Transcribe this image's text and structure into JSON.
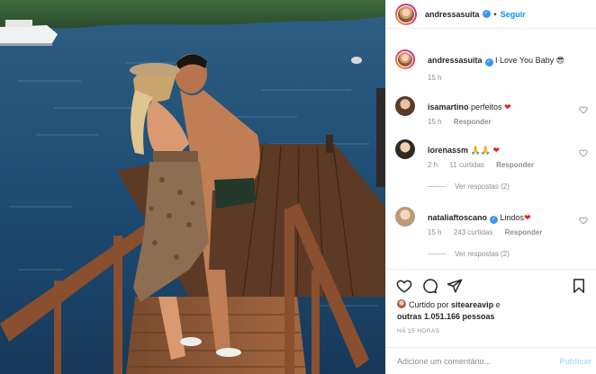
{
  "header": {
    "username": "andressasuita",
    "separator": "•",
    "follow_label": "Seguir"
  },
  "caption": {
    "username": "andressasuita",
    "text": "I Love You Baby 😎",
    "time": "15 h"
  },
  "comments": [
    {
      "username": "isamartino",
      "text": "perfeitos",
      "heart": "❤",
      "time": "15 h",
      "likes": "",
      "reply_label": "Responder",
      "view_replies": ""
    },
    {
      "username": "lorenassm",
      "text": "🙏🙏",
      "heart": "❤",
      "time": "2 h",
      "likes": "11 curtidas",
      "reply_label": "Responder",
      "view_replies": "Ver respostas (2)"
    },
    {
      "username": "nataliaftoscano",
      "text": "Lindos",
      "heart": "❤",
      "time": "15 h",
      "likes": "243 curtidas",
      "reply_label": "Responder",
      "view_replies": "Ver respostas (2)"
    }
  ],
  "likes": {
    "prefix": "Curtido por",
    "user": "siteareavip",
    "middle": "e",
    "others": "outras 1.051.166 pessoas"
  },
  "posted_ago": "HÁ 15 HORAS",
  "comment_box": {
    "placeholder": "Adicione um comentário...",
    "publish_label": "Publicar"
  },
  "icons": {
    "like": "heart-icon",
    "comment": "comment-icon",
    "share": "share-icon",
    "save": "bookmark-icon"
  },
  "colors": {
    "accent": "#0095f6",
    "verified": "#3897f0",
    "heart": "#ed4956",
    "muted": "#8e8e8e"
  }
}
